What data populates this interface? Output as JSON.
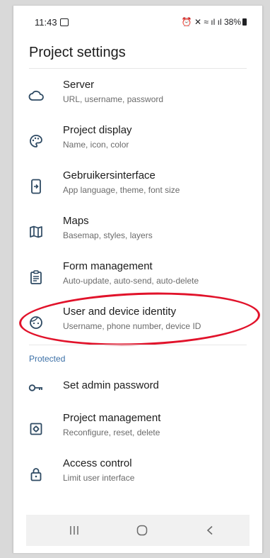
{
  "status_bar": {
    "time": "11:43",
    "battery": "38%"
  },
  "header": {
    "title": "Project settings"
  },
  "items": [
    {
      "label": "Server",
      "sub": "URL, username, password",
      "icon": "cloud-icon"
    },
    {
      "label": "Project display",
      "sub": "Name, icon, color",
      "icon": "palette-icon"
    },
    {
      "label": "Gebruikersinterface",
      "sub": "App language, theme, font size",
      "icon": "phone-interface-icon"
    },
    {
      "label": "Maps",
      "sub": "Basemap, styles, layers",
      "icon": "map-icon"
    },
    {
      "label": "Form management",
      "sub": "Auto-update, auto-send, auto-delete",
      "icon": "clipboard-icon"
    },
    {
      "label": "User and device identity",
      "sub": "Username, phone number, device ID",
      "icon": "face-icon"
    }
  ],
  "protected": {
    "header": "Protected",
    "items": [
      {
        "label": "Set admin password",
        "icon": "key-icon"
      },
      {
        "label": "Project management",
        "sub": "Reconfigure, reset, delete",
        "icon": "settings-box-icon"
      },
      {
        "label": "Access control",
        "sub": "Limit user interface",
        "icon": "lock-icon"
      }
    ]
  },
  "colors": {
    "accent": "#3b6fa6",
    "highlight": "#e1122a",
    "icon": "#2e4a63"
  }
}
